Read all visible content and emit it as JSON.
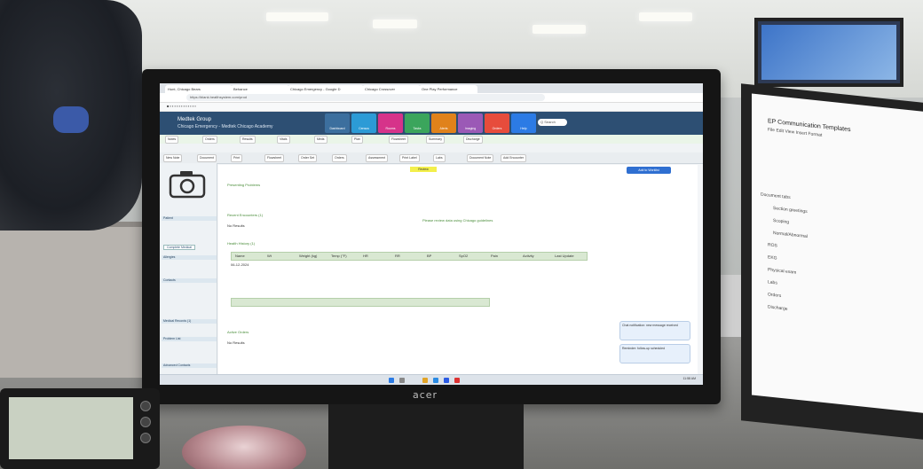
{
  "browser": {
    "tabs": [
      "Hunt, Chicago Bears",
      "Behance",
      "Chicago Emergency - Google D",
      "Chicago Crossover",
      "One Play Performance"
    ],
    "url": "https://blank.healthsystem.com/prod"
  },
  "app": {
    "title": "Medtek Group",
    "subtitle": "Chicago Emergency - Medtek Chicago Academy",
    "nav_tiles": [
      {
        "label": "Dashboard",
        "color": "#3c6f9e"
      },
      {
        "label": "Census",
        "color": "#2c9bd6"
      },
      {
        "label": "Rooms",
        "color": "#d6338a"
      },
      {
        "label": "Tasks",
        "color": "#3ba55c"
      },
      {
        "label": "Alerts",
        "color": "#e0821b"
      },
      {
        "label": "Imaging",
        "color": "#9b59b6"
      },
      {
        "label": "Orders",
        "color": "#e74c3c"
      },
      {
        "label": "Help",
        "color": "#2c7be5"
      }
    ],
    "search_placeholder": "Q Search",
    "toolbar_items": [
      "Notes",
      "Orders",
      "Results",
      "Vitals",
      "Meds",
      "Plan",
      "Flowsheet",
      "Summary",
      "Discharge"
    ],
    "action_buttons": [
      "New Note",
      "Document",
      "Print",
      "Flowsheet",
      "Order Set",
      "Orders",
      "Assessment",
      "Print Label",
      "Labs",
      "Document Note",
      "Add Encounter"
    ],
    "primary_button": "Add to Worklist"
  },
  "sidebar": {
    "sections": [
      "Patient",
      "Allergies",
      "Contacts",
      "Medical Records (1)",
      "Problem List",
      "Advanced Contacts"
    ],
    "details_button": "Complete Medical"
  },
  "content": {
    "section_title": "Presenting Problems",
    "tag": "Review",
    "empty_message": "Please review data using Chicago guidelines",
    "sections": [
      "Recent Encounters (1)",
      "Health History (1)",
      "Active Orders"
    ],
    "no_results": "No Results",
    "table_headers": [
      "Name",
      "Wt",
      "Weight (kg)",
      "Temp (°F)",
      "HR",
      "RR",
      "BP",
      "SpO2",
      "Pain",
      "Activity",
      "Last Update"
    ],
    "row_date": "06-12-2024"
  },
  "notifications": [
    "Chat notification: new message received",
    "Reminder: follow-up scheduled"
  ],
  "taskbar": {
    "time": "11:58 AM",
    "date": "6/12/2024"
  },
  "laptop": {
    "doc_title": "EP Communication Templates",
    "menu": "File  Edit  View  Insert  Format",
    "lines": [
      "Document tabs",
      "Section greetings",
      "Scoping",
      "Normal/Abnormal",
      "ROS",
      "EKG",
      "Physical exam",
      "Labs",
      "Orders",
      "Discharge"
    ]
  },
  "monitor": {
    "brand": "acer"
  }
}
